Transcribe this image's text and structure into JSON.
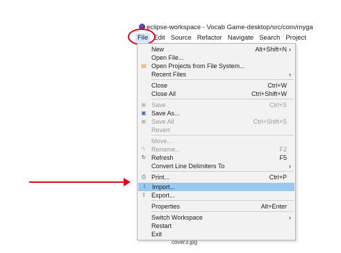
{
  "window": {
    "title": "eclipse-workspace - Vocab Game-desktop/src/com/myga"
  },
  "menu_bar": {
    "items": [
      "File",
      "Edit",
      "Source",
      "Refactor",
      "Navigate",
      "Search",
      "Project"
    ],
    "active": "File"
  },
  "file_menu": {
    "items": [
      {
        "label": "New",
        "shortcut": "Alt+Shift+N",
        "submenu": true,
        "icon": "",
        "enabled": true
      },
      {
        "label": "Open File...",
        "shortcut": "",
        "submenu": false,
        "icon": "",
        "enabled": true
      },
      {
        "label": "Open Projects from File System...",
        "shortcut": "",
        "submenu": false,
        "icon": "folder-icon",
        "enabled": true
      },
      {
        "label": "Recent Files",
        "shortcut": "",
        "submenu": true,
        "icon": "",
        "enabled": true
      },
      {
        "label": "Close",
        "shortcut": "Ctrl+W",
        "submenu": false,
        "icon": "",
        "enabled": true
      },
      {
        "label": "Close All",
        "shortcut": "Ctrl+Shift+W",
        "submenu": false,
        "icon": "",
        "enabled": true
      },
      {
        "label": "Save",
        "shortcut": "Ctrl+S",
        "submenu": false,
        "icon": "save-icon",
        "enabled": false
      },
      {
        "label": "Save As...",
        "shortcut": "",
        "submenu": false,
        "icon": "save-as-icon",
        "enabled": true
      },
      {
        "label": "Save All",
        "shortcut": "Ctrl+Shift+S",
        "submenu": false,
        "icon": "save-all-icon",
        "enabled": false
      },
      {
        "label": "Revert",
        "shortcut": "",
        "submenu": false,
        "icon": "",
        "enabled": false
      },
      {
        "label": "Move...",
        "shortcut": "",
        "submenu": false,
        "icon": "",
        "enabled": false
      },
      {
        "label": "Rename...",
        "shortcut": "F2",
        "submenu": false,
        "icon": "rename-icon",
        "enabled": false
      },
      {
        "label": "Refresh",
        "shortcut": "F5",
        "submenu": false,
        "icon": "refresh-icon",
        "enabled": true
      },
      {
        "label": "Convert Line Delimiters To",
        "shortcut": "",
        "submenu": true,
        "icon": "",
        "enabled": true
      },
      {
        "label": "Print...",
        "shortcut": "Ctrl+P",
        "submenu": false,
        "icon": "print-icon",
        "enabled": true
      },
      {
        "label": "Import...",
        "shortcut": "",
        "submenu": false,
        "icon": "import-icon",
        "enabled": true,
        "highlighted": true
      },
      {
        "label": "Export...",
        "shortcut": "",
        "submenu": false,
        "icon": "export-icon",
        "enabled": true
      },
      {
        "label": "Properties",
        "shortcut": "Alt+Enter",
        "submenu": false,
        "icon": "",
        "enabled": true
      },
      {
        "label": "Switch Workspace",
        "shortcut": "",
        "submenu": true,
        "icon": "",
        "enabled": true
      },
      {
        "label": "Restart",
        "shortcut": "",
        "submenu": false,
        "icon": "",
        "enabled": true
      },
      {
        "label": "Exit",
        "shortcut": "",
        "submenu": false,
        "icon": "",
        "enabled": true
      }
    ]
  },
  "background_file": {
    "label": "cover3.jpg"
  },
  "annotations": {
    "color": "#e0001b"
  }
}
